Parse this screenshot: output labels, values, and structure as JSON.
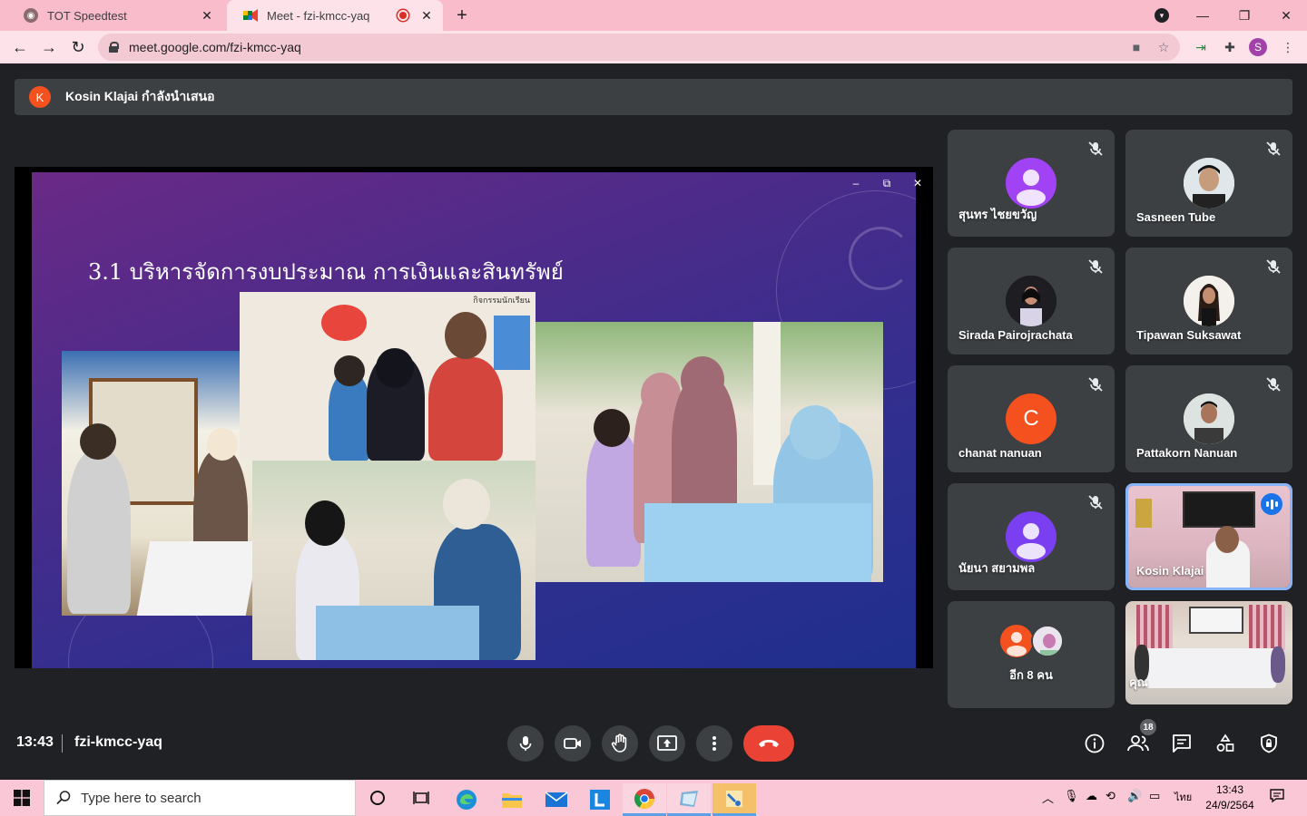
{
  "browser": {
    "tabs": [
      {
        "title": "TOT Speedtest"
      },
      {
        "title": "Meet - fzi-kmcc-yaq"
      }
    ],
    "new_tab": "+",
    "url": "meet.google.com/fzi-kmcc-yaq",
    "profile_initial": "S"
  },
  "meet": {
    "presenter_initial": "K",
    "presenter_text": "Kosin Klajai กำลังนำเสนอ",
    "slide_title": "3.1 บริหารจัดการงบประมาณ การเงินและสินทรัพย์",
    "slide_photo_caption": "กิจกรรมนักเรียน",
    "participants": [
      {
        "name": "สุนทร ไชยขวัญ",
        "avatar_color": "#a142f4",
        "muted": true
      },
      {
        "name": "Sasneen Tube",
        "muted": true
      },
      {
        "name": "Sirada Pairojrachata",
        "muted": true
      },
      {
        "name": "Tipawan Suksawat",
        "muted": true
      },
      {
        "name": "chanat nanuan",
        "initial": "C",
        "avatar_color": "#f4511e",
        "muted": true
      },
      {
        "name": "Pattakorn Nanuan",
        "muted": true
      },
      {
        "name": "นัยนา สยามพล",
        "avatar_color": "#7b3ff2",
        "muted": true
      },
      {
        "name": "Kosin Klajai",
        "speaking": true
      },
      {
        "name": "อีก 8 คน"
      },
      {
        "name": "คุณ"
      }
    ],
    "time": "13:43",
    "meeting_code": "fzi-kmcc-yaq",
    "people_count": "18"
  },
  "taskbar": {
    "search_placeholder": "Type here to search",
    "language": "ไทย",
    "time": "13:43",
    "date": "24/9/2564"
  },
  "colors": {
    "tabbar": "#f8bccb",
    "toolbar": "#fde2e9",
    "meet_bg": "#202124",
    "tile_bg": "#3c4043",
    "hangup": "#ea4335",
    "active_border": "#8ab4f8"
  }
}
